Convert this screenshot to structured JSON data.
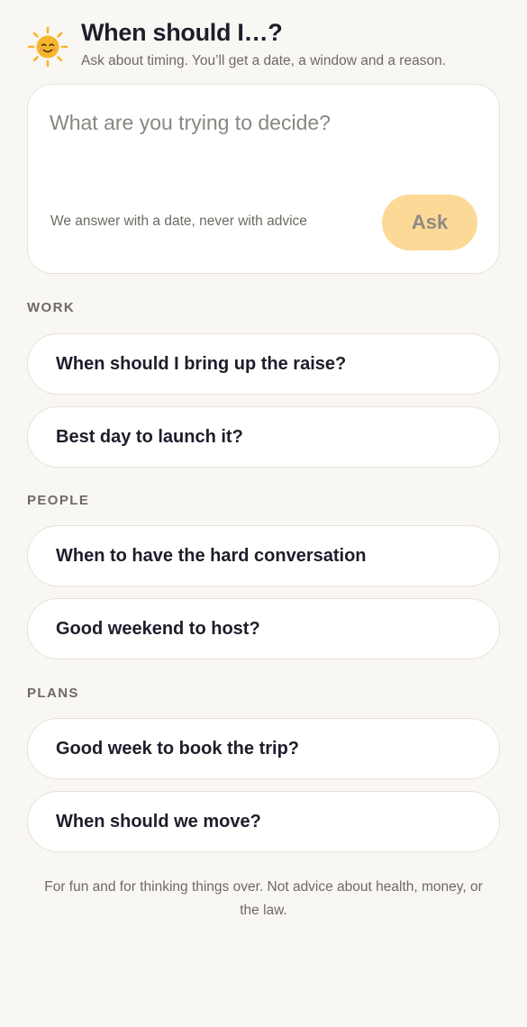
{
  "header": {
    "icon": "sun-face-icon",
    "title": "When should I…?",
    "subtitle": "Ask about timing. You’ll get a date, a window and a reason."
  },
  "ask": {
    "placeholder": "What are you trying to decide?",
    "hint": "We answer with a date, never with advice",
    "button_label": "Ask"
  },
  "sections": [
    {
      "label": "WORK",
      "prompts": [
        "When should I bring up the raise?",
        "Best day to launch it?"
      ]
    },
    {
      "label": "PEOPLE",
      "prompts": [
        "When to have the hard conversation",
        "Good weekend to host?"
      ]
    },
    {
      "label": "PLANS",
      "prompts": [
        "Good week to book the trip?",
        "When should we move?"
      ]
    }
  ],
  "footer": {
    "disclaimer": "For fun and for thinking things over. Not advice about health, money, or the law."
  },
  "colors": {
    "background": "#f9f7f3",
    "accent": "#fdd997",
    "sun": "#f7b52c",
    "text": "#1f1d2b",
    "muted": "#6e6a63"
  }
}
